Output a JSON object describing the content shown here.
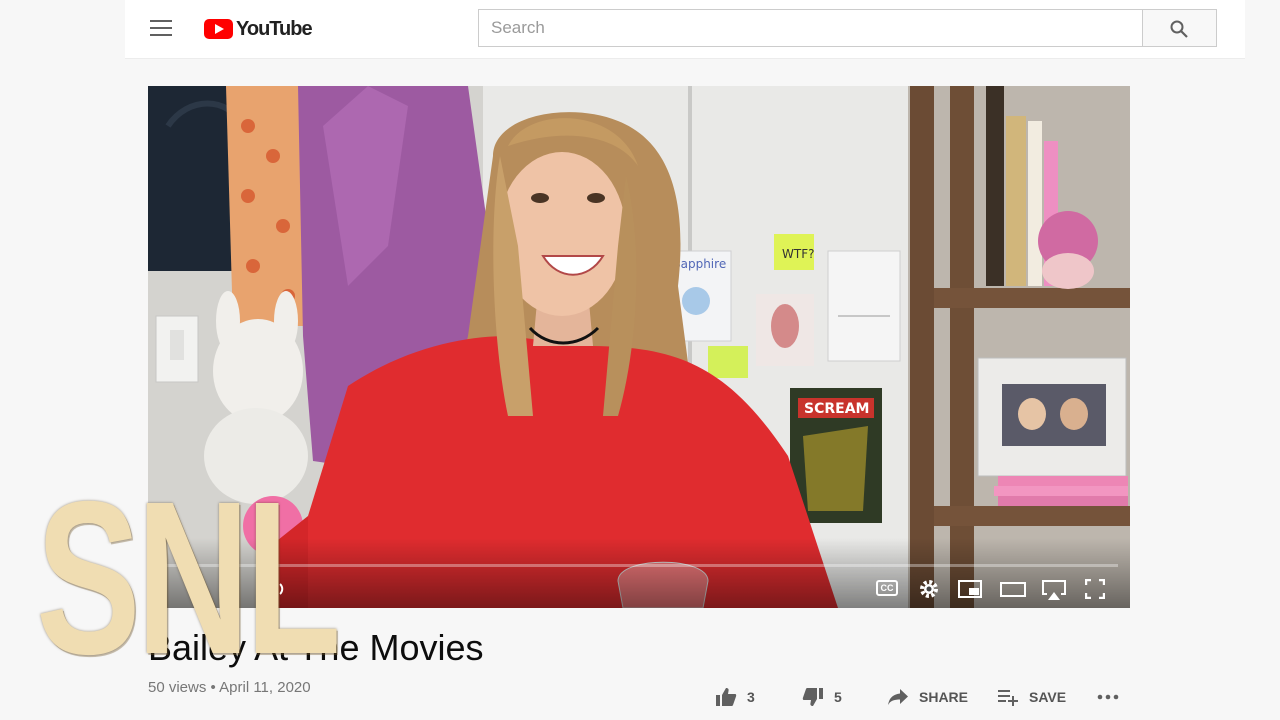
{
  "header": {
    "brand": "YouTube",
    "search": {
      "placeholder": "Search",
      "value": ""
    }
  },
  "player": {
    "progress": 0.004,
    "controls": [
      "volume-icon",
      "cc-icon",
      "gear-icon",
      "miniplayer-icon",
      "theater-icon",
      "airplay-icon",
      "fullscreen-icon"
    ],
    "cc_label": "CC"
  },
  "video": {
    "title": "Bailey At The Movies",
    "views": "50 views",
    "separator": "•",
    "date": "April 11, 2020"
  },
  "actions": {
    "like_count": "3",
    "dislike_count": "5",
    "share_label": "SHARE",
    "save_label": "SAVE"
  },
  "overlay": {
    "logo": "SNL"
  },
  "colors": {
    "brand": "#ff0000",
    "progress": "#ff0000",
    "snl_gold": "#f0ddb2"
  }
}
